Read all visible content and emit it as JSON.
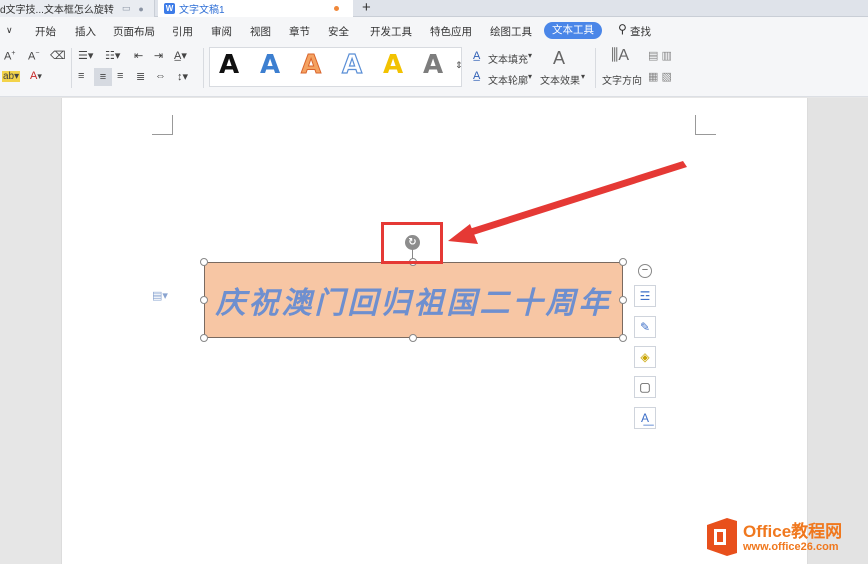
{
  "tabs": [
    {
      "label": "d文字技...文本框怎么旋转"
    },
    {
      "label": "文字文稿1",
      "app_letter": "W"
    }
  ],
  "menu": {
    "items": [
      "开始",
      "插入",
      "页面布局",
      "引用",
      "审阅",
      "视图",
      "章节",
      "安全",
      "开发工具",
      "特色应用",
      "绘图工具"
    ],
    "active": "文本工具",
    "search": "查找"
  },
  "toolbar": {
    "wordart_glyph": "A",
    "text_fill": "文本填充",
    "text_outline": "文本轮廓",
    "text_effect": "文本效果",
    "text_direction": "文字方向"
  },
  "document": {
    "textbox_text": "庆祝澳门回归祖国二十周年"
  },
  "watermark": {
    "brand": "Office教程网",
    "url": "www.office26.com"
  },
  "colors": {
    "accent": "#4a86e8",
    "textbox_fill": "#f7c6a4",
    "textbox_text": "#6e8fcf",
    "highlight": "#e53935"
  }
}
